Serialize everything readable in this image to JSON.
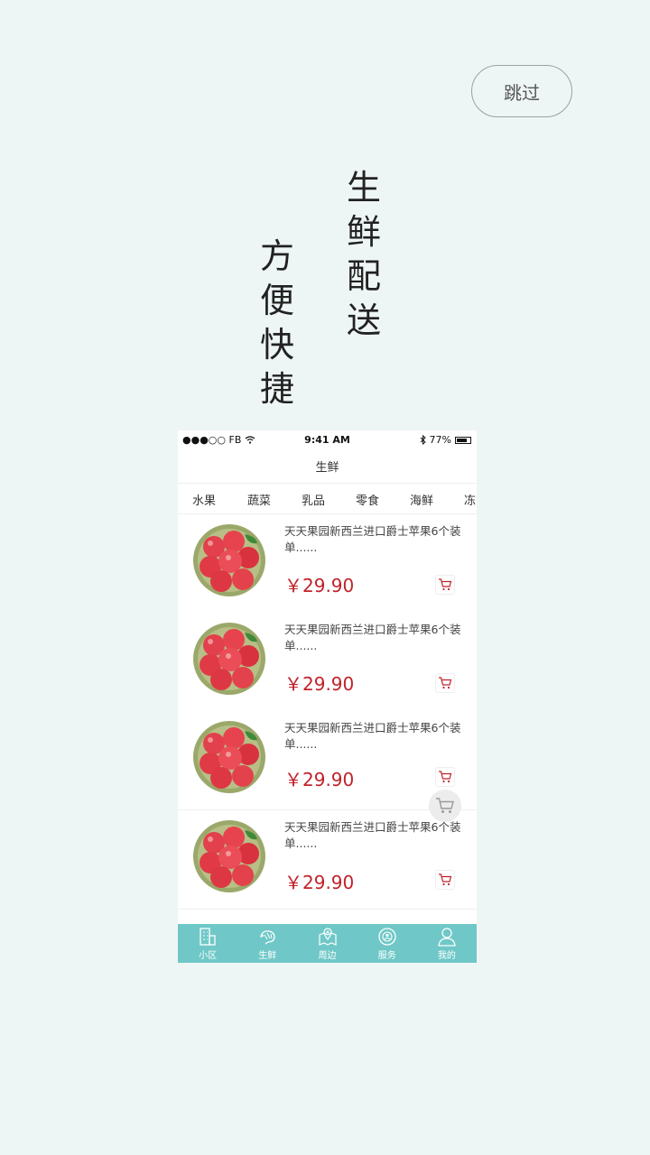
{
  "skip_label": "跳过",
  "slogan": {
    "line1": "生\n鲜\n配\n送",
    "line2": "方\n便\n快\n捷"
  },
  "phone": {
    "status": {
      "carrier": "●●●○○ FB",
      "time": "9:41 AM",
      "battery": "77%"
    },
    "title": "生鲜",
    "categories": [
      "水果",
      "蔬菜",
      "乳品",
      "零食",
      "海鲜",
      "冻"
    ],
    "products": [
      {
        "title": "天天果园新西兰进口爵士苹果6个装单......",
        "price": "￥29.90"
      },
      {
        "title": "天天果园新西兰进口爵士苹果6个装单......",
        "price": "￥29.90"
      },
      {
        "title": "天天果园新西兰进口爵士苹果6个装单......",
        "price": "￥29.90"
      },
      {
        "title": "天天果园新西兰进口爵士苹果6个装单......",
        "price": "￥29.90"
      }
    ],
    "tabs": [
      {
        "label": "小区",
        "icon": "building-icon"
      },
      {
        "label": "生鲜",
        "icon": "shrimp-icon"
      },
      {
        "label": "周边",
        "icon": "map-pin-icon"
      },
      {
        "label": "服务",
        "icon": "service-icon"
      },
      {
        "label": "我的",
        "icon": "user-icon"
      }
    ]
  },
  "colors": {
    "background": "#eef6f5",
    "tabbar": "#6fc8c7",
    "price": "#c0222a"
  }
}
